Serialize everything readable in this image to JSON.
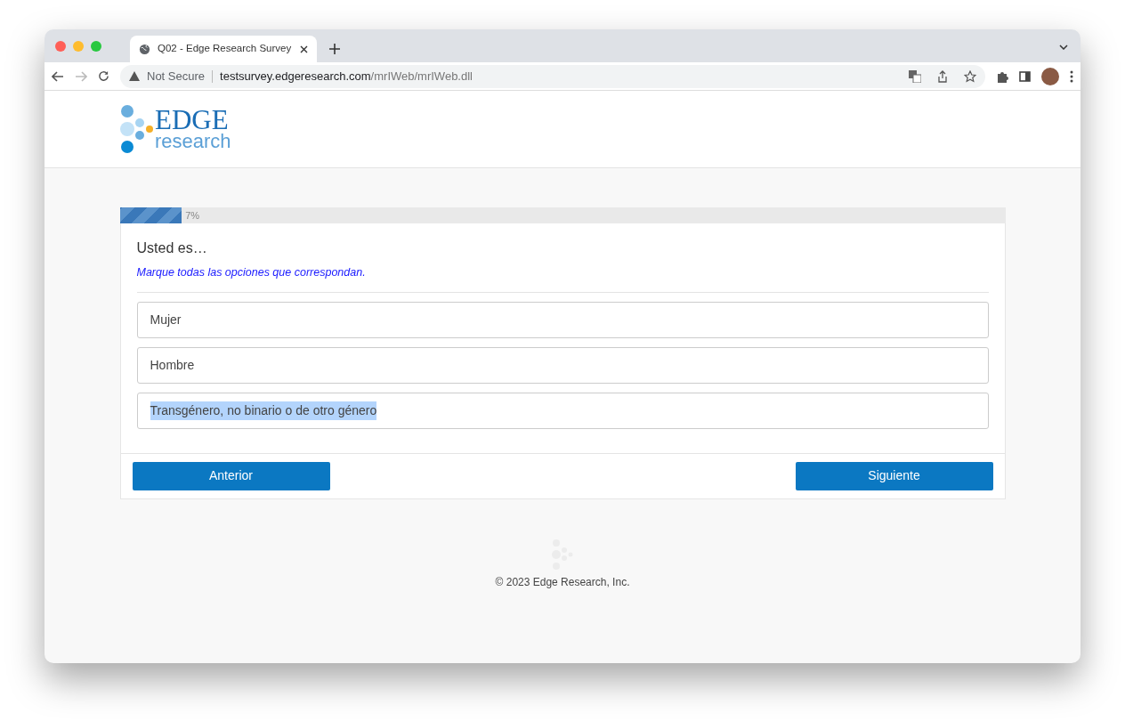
{
  "browser": {
    "tab_title": "Q02 - Edge Research Survey",
    "security_label": "Not Secure",
    "url_host": "testsurvey.edgeresearch.com",
    "url_path": "/mrIWeb/mrIWeb.dll"
  },
  "logo": {
    "word_1": "EDGE",
    "word_2": "research"
  },
  "progress": {
    "level": 0.07,
    "label": "7%"
  },
  "question": {
    "text": "Usted es…",
    "instruction": "Marque todas las opciones que correspondan."
  },
  "options": [
    {
      "label": "Mujer",
      "highlighted": false
    },
    {
      "label": "Hombre",
      "highlighted": false
    },
    {
      "label": "Transgénero, no binario o de otro género",
      "highlighted": true
    }
  ],
  "buttons": {
    "previous": "Anterior",
    "next": "Siguiente"
  },
  "footer": {
    "copyright": "© 2023 Edge Research, Inc."
  }
}
